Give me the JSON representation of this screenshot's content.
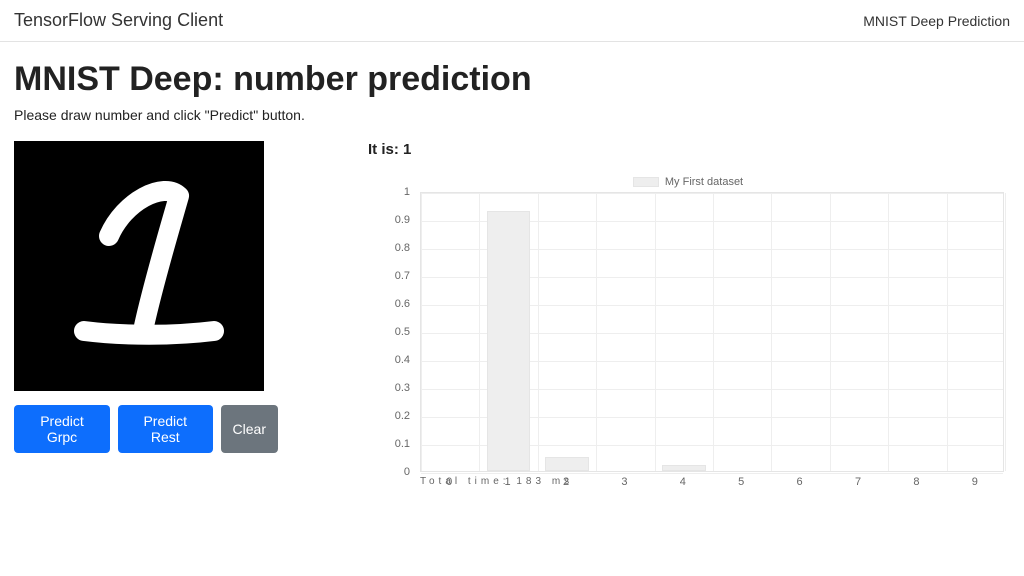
{
  "navbar": {
    "brand": "TensorFlow Serving Client",
    "link": "MNIST Deep Prediction"
  },
  "page": {
    "title": "MNIST Deep: number prediction",
    "subtitle": "Please draw number and click \"Predict\" button."
  },
  "buttons": {
    "predict_grpc": "Predict Grpc",
    "predict_rest": "Predict Rest",
    "clear": "Clear"
  },
  "result": {
    "prefix": "It is: ",
    "value": "1"
  },
  "chart_data": {
    "type": "bar",
    "legend": "My First dataset",
    "categories": [
      "0",
      "1",
      "2",
      "3",
      "4",
      "5",
      "6",
      "7",
      "8",
      "9"
    ],
    "values": [
      0,
      0.93,
      0.05,
      0,
      0.02,
      0,
      0,
      0,
      0,
      0
    ],
    "ylim": [
      0,
      1.0
    ],
    "yticks": [
      0,
      0.1,
      0.2,
      0.3,
      0.4,
      0.5,
      0.6,
      0.7,
      0.8,
      0.9,
      1.0
    ],
    "xlabel": "",
    "ylabel": "",
    "title": ""
  },
  "timing": {
    "total_time_label": "Total time:",
    "total_time_value": "183",
    "total_time_unit": "ms"
  },
  "colors": {
    "primary_button": "#0d6efd",
    "secondary_button": "#6c757d",
    "bar_fill": "#eeeeee",
    "grid_line": "#eeeeee",
    "canvas_bg": "#000000"
  }
}
